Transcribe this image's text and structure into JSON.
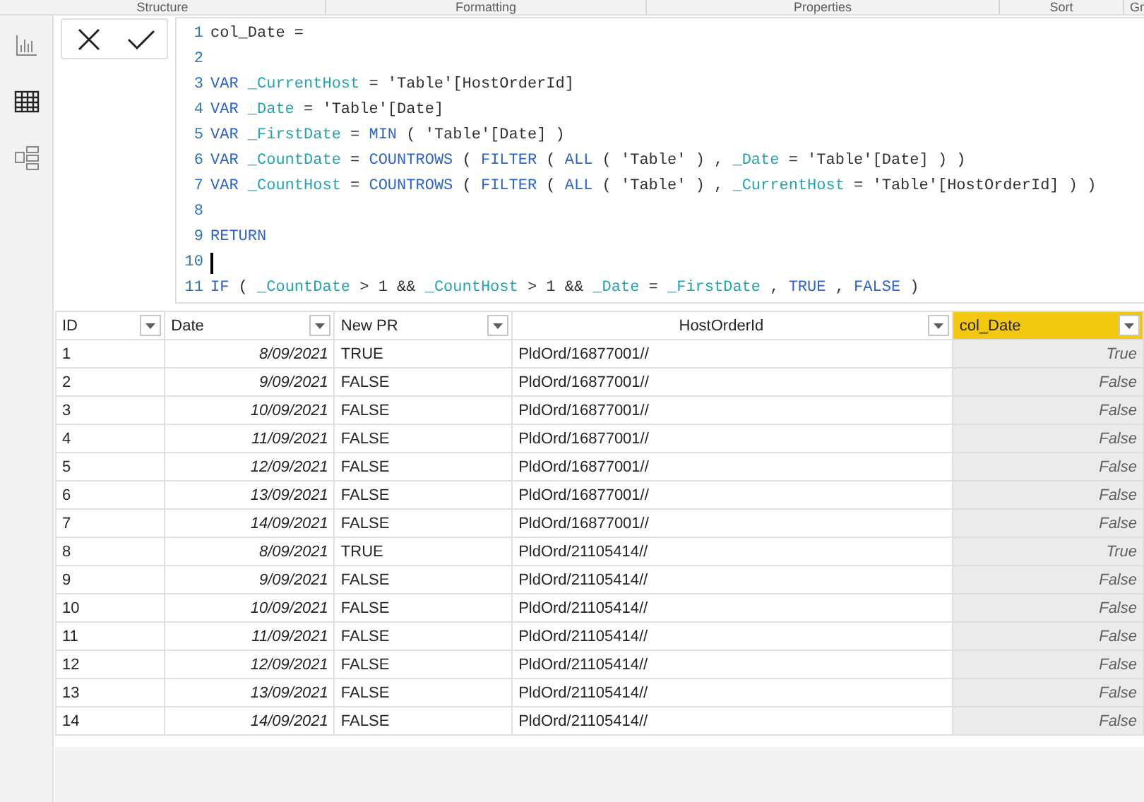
{
  "ribbon": {
    "groups": [
      "Structure",
      "Formatting",
      "Properties",
      "Sort",
      "Gr"
    ]
  },
  "sidebar": {
    "items": [
      {
        "kind": "report",
        "selected": false
      },
      {
        "kind": "data",
        "selected": true
      },
      {
        "kind": "model",
        "selected": false
      }
    ]
  },
  "formula_bar": {
    "lines": [
      {
        "number": "1",
        "cursor": false,
        "tokens": [
          {
            "kind": "plain",
            "text": "col_Date ="
          }
        ]
      },
      {
        "number": "2",
        "cursor": false
      },
      {
        "number": "3",
        "cursor": false,
        "tokens": [
          {
            "kind": "keyword",
            "text": "VAR "
          },
          {
            "kind": "variable",
            "text": "_CurrentHost"
          },
          {
            "kind": "plain",
            "text": " = 'Table'[HostOrderId]"
          }
        ]
      },
      {
        "number": "4",
        "cursor": false,
        "tokens": [
          {
            "kind": "keyword",
            "text": "VAR "
          },
          {
            "kind": "variable",
            "text": "_Date"
          },
          {
            "kind": "plain",
            "text": " = 'Table'[Date]"
          }
        ]
      },
      {
        "number": "5",
        "cursor": false,
        "tokens": [
          {
            "kind": "keyword",
            "text": "VAR "
          },
          {
            "kind": "variable",
            "text": "_FirstDate"
          },
          {
            "kind": "plain",
            "text": " = "
          },
          {
            "kind": "keyword",
            "text": "MIN"
          },
          {
            "kind": "plain",
            "text": " ( 'Table'[Date] )"
          }
        ]
      },
      {
        "number": "6",
        "cursor": false,
        "tokens": [
          {
            "kind": "keyword",
            "text": "VAR "
          },
          {
            "kind": "variable",
            "text": "_CountDate"
          },
          {
            "kind": "plain",
            "text": " = "
          },
          {
            "kind": "keyword",
            "text": "COUNTROWS"
          },
          {
            "kind": "plain",
            "text": " ( "
          },
          {
            "kind": "keyword",
            "text": "FILTER"
          },
          {
            "kind": "plain",
            "text": " ( "
          },
          {
            "kind": "keyword",
            "text": "ALL"
          },
          {
            "kind": "plain",
            "text": " ( 'Table' ) , "
          },
          {
            "kind": "variable",
            "text": "_Date"
          },
          {
            "kind": "plain",
            "text": " = 'Table'[Date] ) )"
          }
        ]
      },
      {
        "number": "7",
        "cursor": false,
        "tokens": [
          {
            "kind": "keyword",
            "text": "VAR "
          },
          {
            "kind": "variable",
            "text": "_CountHost"
          },
          {
            "kind": "plain",
            "text": " = "
          },
          {
            "kind": "keyword",
            "text": "COUNTROWS"
          },
          {
            "kind": "plain",
            "text": " ( "
          },
          {
            "kind": "keyword",
            "text": "FILTER"
          },
          {
            "kind": "plain",
            "text": " ( "
          },
          {
            "kind": "keyword",
            "text": "ALL"
          },
          {
            "kind": "plain",
            "text": " ( 'Table' ) , "
          },
          {
            "kind": "variable",
            "text": "_CurrentHost"
          },
          {
            "kind": "plain",
            "text": " = 'Table'[HostOrderId] ) )"
          }
        ]
      },
      {
        "number": "8",
        "cursor": false
      },
      {
        "number": "9",
        "cursor": false,
        "tokens": [
          {
            "kind": "keyword",
            "text": "RETURN"
          }
        ]
      },
      {
        "number": "10",
        "cursor": true
      },
      {
        "number": "11",
        "cursor": false,
        "tokens": [
          {
            "kind": "keyword",
            "text": "IF"
          },
          {
            "kind": "plain",
            "text": " ( "
          },
          {
            "kind": "variable",
            "text": "_CountDate"
          },
          {
            "kind": "plain",
            "text": " > 1 && "
          },
          {
            "kind": "variable",
            "text": "_CountHost"
          },
          {
            "kind": "plain",
            "text": " > 1 && "
          },
          {
            "kind": "variable",
            "text": "_Date"
          },
          {
            "kind": "plain",
            "text": " = "
          },
          {
            "kind": "variable",
            "text": "_FirstDate"
          },
          {
            "kind": "plain",
            "text": " , "
          },
          {
            "kind": "keyword",
            "text": "TRUE"
          },
          {
            "kind": "plain",
            "text": " , "
          },
          {
            "kind": "keyword",
            "text": "FALSE"
          },
          {
            "kind": "plain",
            "text": " )"
          }
        ]
      }
    ]
  },
  "table": {
    "columns": [
      {
        "label": "ID",
        "kind": "text",
        "selected": false
      },
      {
        "label": "Date",
        "kind": "date",
        "selected": false
      },
      {
        "label": "New PR",
        "kind": "text",
        "selected": false
      },
      {
        "label": "HostOrderId",
        "kind": "text",
        "selected": false
      },
      {
        "label": "col_Date",
        "kind": "computed",
        "selected": true
      }
    ],
    "rows": [
      [
        "1",
        "8/09/2021",
        "TRUE",
        "PldOrd/16877001//",
        "True"
      ],
      [
        "2",
        "9/09/2021",
        "FALSE",
        "PldOrd/16877001//",
        "False"
      ],
      [
        "3",
        "10/09/2021",
        "FALSE",
        "PldOrd/16877001//",
        "False"
      ],
      [
        "4",
        "11/09/2021",
        "FALSE",
        "PldOrd/16877001//",
        "False"
      ],
      [
        "5",
        "12/09/2021",
        "FALSE",
        "PldOrd/16877001//",
        "False"
      ],
      [
        "6",
        "13/09/2021",
        "FALSE",
        "PldOrd/16877001//",
        "False"
      ],
      [
        "7",
        "14/09/2021",
        "FALSE",
        "PldOrd/16877001//",
        "False"
      ],
      [
        "8",
        "8/09/2021",
        "TRUE",
        "PldOrd/21105414//",
        "True"
      ],
      [
        "9",
        "9/09/2021",
        "FALSE",
        "PldOrd/21105414//",
        "False"
      ],
      [
        "10",
        "10/09/2021",
        "FALSE",
        "PldOrd/21105414//",
        "False"
      ],
      [
        "11",
        "11/09/2021",
        "FALSE",
        "PldOrd/21105414//",
        "False"
      ],
      [
        "12",
        "12/09/2021",
        "FALSE",
        "PldOrd/21105414//",
        "False"
      ],
      [
        "13",
        "13/09/2021",
        "FALSE",
        "PldOrd/21105414//",
        "False"
      ],
      [
        "14",
        "14/09/2021",
        "FALSE",
        "PldOrd/21105414//",
        "False"
      ]
    ]
  }
}
